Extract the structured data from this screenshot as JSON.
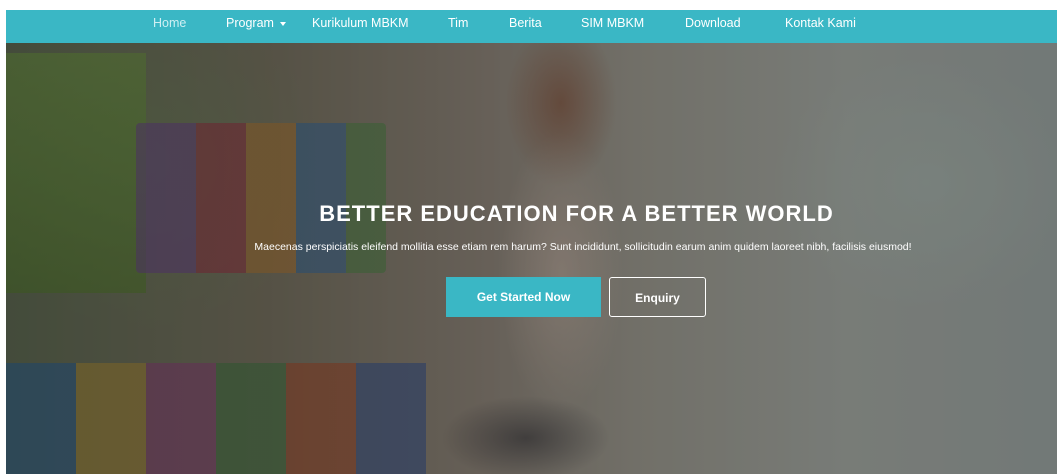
{
  "nav": {
    "items": [
      {
        "label": "Home",
        "active": true
      },
      {
        "label": "Program",
        "dropdown": true
      },
      {
        "label": "Kurikulum MBKM"
      },
      {
        "label": "Tim"
      },
      {
        "label": "Berita"
      },
      {
        "label": "SIM MBKM"
      },
      {
        "label": "Download"
      },
      {
        "label": "Kontak Kami"
      }
    ]
  },
  "hero": {
    "title": "BETTER EDUCATION FOR A BETTER WORLD",
    "subtitle": "Maecenas perspiciatis eleifend mollitia esse etiam rem harum? Sunt incididunt, sollicitudin earum anim quidem laoreet nibh, facilisis eiusmod!",
    "primary_button": "Get Started Now",
    "secondary_button": "Enquiry"
  },
  "colors": {
    "accent": "#3ab7c5",
    "text_on_dark": "#ffffff"
  }
}
